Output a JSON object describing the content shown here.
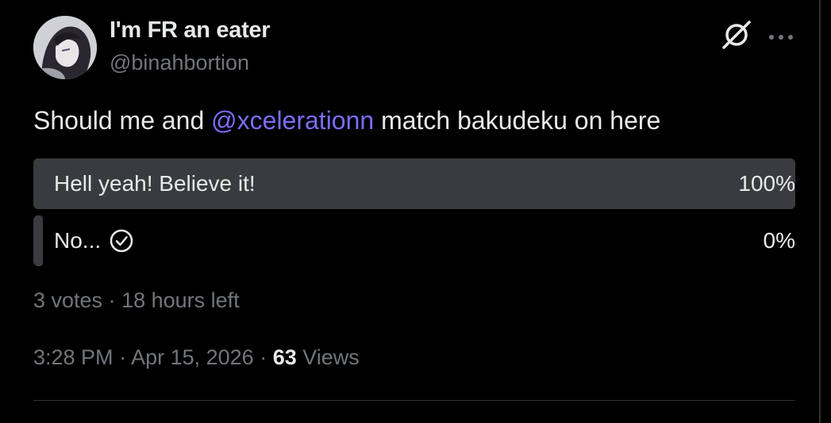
{
  "user": {
    "display_name": "I'm FR an eater",
    "handle": "@binahbortion"
  },
  "tweet": {
    "text_before": "Should me and ",
    "mention": "@xcelerationn",
    "text_after": " match bakudeku on here"
  },
  "poll": {
    "options": [
      {
        "label": "Hell yeah! Believe it!",
        "percent": "100%",
        "share": 1.0
      },
      {
        "label": "No...",
        "percent": "0%",
        "share": 0.0
      }
    ],
    "votes": "3 votes",
    "separator": " · ",
    "time_left": "18 hours left"
  },
  "meta": {
    "time": "3:28 PM",
    "date": "Apr 15, 2026",
    "views_count": "63",
    "views_label": "Views",
    "separator": " · "
  },
  "icons": {
    "header_action": "grok-icon",
    "menu": "more-horizontal-icon",
    "selected_option": "check-circle-icon"
  },
  "colors": {
    "background": "#000000",
    "text": "#e7e9ea",
    "secondary": "#71767b",
    "mention": "#7c6cf5",
    "poll_fill": "#3a3b3f"
  }
}
